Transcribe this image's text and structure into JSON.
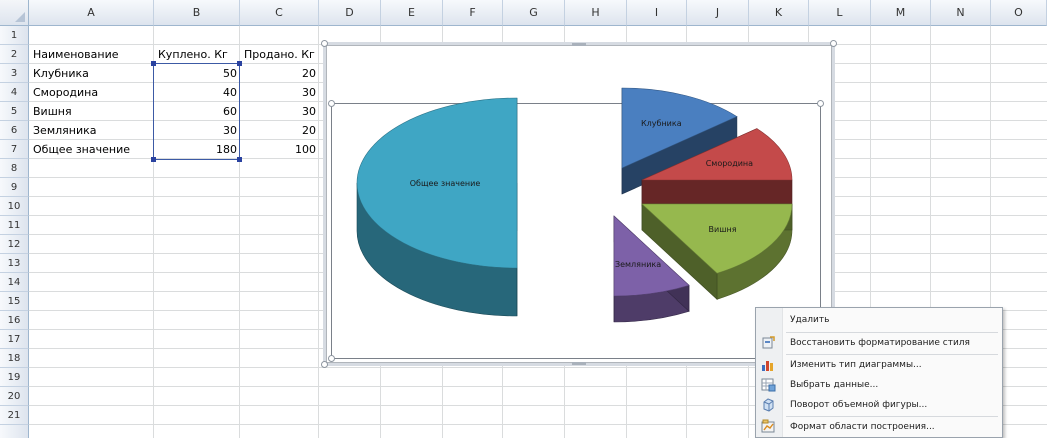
{
  "sheet": {
    "columns": [
      "A",
      "B",
      "C",
      "D",
      "E",
      "F",
      "G",
      "H",
      "I",
      "J",
      "K",
      "L",
      "M",
      "N",
      "O"
    ],
    "rows": [
      "1",
      "2",
      "3",
      "4",
      "5",
      "6",
      "7",
      "8",
      "9",
      "10",
      "11",
      "12",
      "13",
      "14",
      "15",
      "16",
      "17",
      "18",
      "19",
      "20",
      "21"
    ],
    "header_row": {
      "name": "Наименование",
      "bought": "Куплено. Кг",
      "sold": "Продано. Кг"
    },
    "data_rows": [
      {
        "name": "Клубника",
        "bought": "50",
        "sold": "20"
      },
      {
        "name": "Смородина",
        "bought": "40",
        "sold": "30"
      },
      {
        "name": "Вишня",
        "bought": "60",
        "sold": "30"
      },
      {
        "name": "Земляника",
        "bought": "30",
        "sold": "20"
      },
      {
        "name": "Общее значение",
        "bought": "180",
        "sold": "100"
      }
    ]
  },
  "chart": {
    "slice_labels": {
      "total": "Общее значение",
      "strawberry": "Клубника",
      "currant": "Смородина",
      "cherry": "Вишня",
      "wild_strawberry": "Земляника"
    }
  },
  "chart_data": {
    "type": "pie",
    "categories": [
      "Клубника",
      "Смородина",
      "Вишня",
      "Земляника",
      "Общее значение"
    ],
    "values": [
      50,
      40,
      60,
      30,
      180
    ],
    "colors": [
      "#4a7fc0",
      "#c44a4a",
      "#96b84e",
      "#7d61a8",
      "#3fa6c4"
    ]
  },
  "context_menu": {
    "items": [
      {
        "label": "Удалить",
        "icon": "none"
      },
      {
        "label": "Восстановить форматирование стиля",
        "icon": "reset-style-icon"
      },
      {
        "label": "Изменить тип диаграммы...",
        "icon": "chart-type-icon"
      },
      {
        "label": "Выбрать данные...",
        "icon": "select-data-icon"
      },
      {
        "label": "Поворот объемной фигуры...",
        "icon": "3d-rotation-icon"
      },
      {
        "label": "Формат области построения...",
        "icon": "format-plot-area-icon"
      }
    ]
  }
}
